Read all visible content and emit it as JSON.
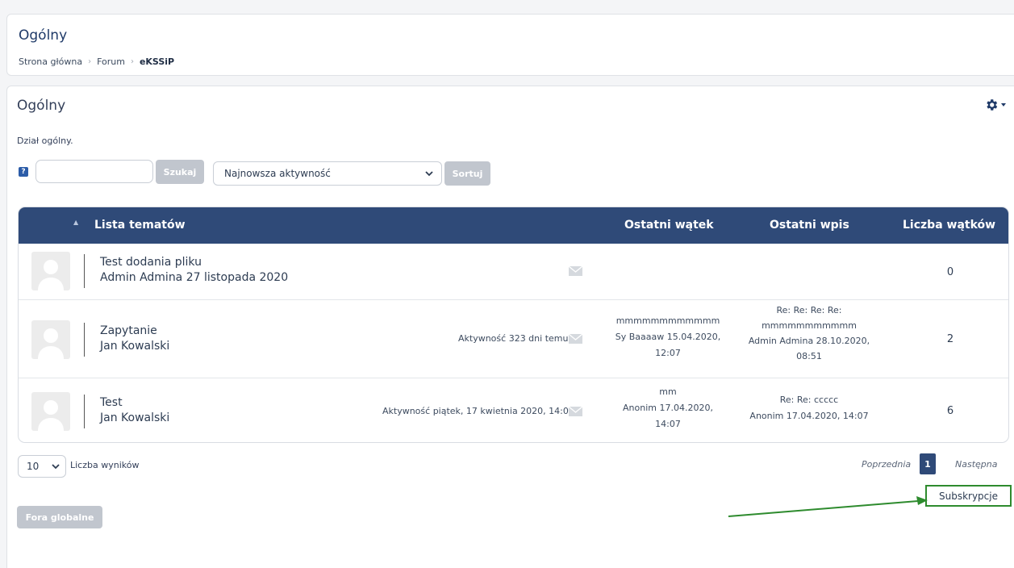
{
  "header": {
    "title": "Ogólny",
    "breadcrumb": [
      "Strona główna",
      "Forum",
      "eKSSiP"
    ]
  },
  "forum": {
    "title": "Ogólny",
    "description": "Dział ogólny."
  },
  "controls": {
    "help_icon": "?",
    "search_value": "",
    "search_button": "Szukaj",
    "sort_selected": "Najnowsza aktywność",
    "sort_button": "Sortuj"
  },
  "table": {
    "headers": [
      "Lista tematów",
      "Ostatni wątek",
      "Ostatni wpis",
      "Liczba wątków"
    ],
    "rows": [
      {
        "title": "Test dodania pliku",
        "author": "Admin Admina 27 listopada 2020",
        "activity": "",
        "last_thread": [],
        "last_post": [],
        "count": "0"
      },
      {
        "title": "Zapytanie",
        "author": "Jan Kowalski",
        "activity": "Aktywność 323 dni temu",
        "last_thread": [
          "mmmmmmmmmmmm",
          "Sy Baaaaw 15.04.2020,",
          "12:07"
        ],
        "last_post": [
          "Re: Re: Re: Re:",
          "mmmmmmmmmmm",
          "Admin Admina 28.10.2020,",
          "08:51"
        ],
        "count": "2"
      },
      {
        "title": "Test",
        "author": "Jan Kowalski",
        "activity": "Aktywność piątek, 17 kwietnia 2020, 14:07",
        "last_thread": [
          "mm",
          "Anonim 17.04.2020,",
          "14:07"
        ],
        "last_post": [
          "Re: Re: ccccc",
          "Anonim 17.04.2020, 14:07"
        ],
        "count": "6"
      }
    ]
  },
  "pagination": {
    "per_page": "10",
    "per_page_label": "Liczba wyników",
    "prev": "Poprzednia",
    "current": "1",
    "next": "Następna"
  },
  "subscribe_button": "Subskrypcje",
  "global_forums_button": "Fora globalne",
  "colors": {
    "header_bg": "#2f4a78",
    "annotation": "#2e8b2e",
    "disabled_button": "#c1c6ce"
  },
  "icons": [
    "gear-icon",
    "help-icon",
    "chevron-down-icon",
    "mail-icon",
    "avatar-icon"
  ]
}
